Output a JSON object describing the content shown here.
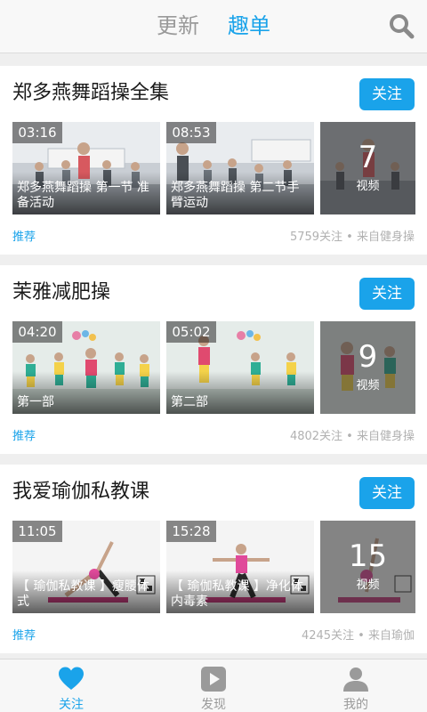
{
  "header": {
    "tabs": [
      {
        "label": "更新"
      },
      {
        "label": "趣单"
      }
    ],
    "search_icon": "search-icon",
    "accent": "#1aa3ea"
  },
  "playlists": [
    {
      "title": "郑多燕舞蹈操全集",
      "follow_label": "关注",
      "tag": "推荐",
      "meta": "5759关注 • 来自健身操",
      "videos": [
        {
          "duration": "03:16",
          "caption": "郑多燕舞蹈操 第一节 准备活动"
        },
        {
          "duration": "08:53",
          "caption": "郑多燕舞蹈操 第二节手臂运动"
        }
      ],
      "more": {
        "count": "7",
        "unit": "视频"
      }
    },
    {
      "title": "茉雅减肥操",
      "follow_label": "关注",
      "tag": "推荐",
      "meta": "4802关注 • 来自健身操",
      "videos": [
        {
          "duration": "04:20",
          "caption": "第一部"
        },
        {
          "duration": "05:02",
          "caption": "第二部"
        }
      ],
      "more": {
        "count": "9",
        "unit": "视频"
      }
    },
    {
      "title": "我爱瑜伽私教课",
      "follow_label": "关注",
      "tag": "推荐",
      "meta": "4245关注 • 来自瑜伽",
      "videos": [
        {
          "duration": "11:05",
          "caption": "【 瑜伽私教课 】瘦腰体式"
        },
        {
          "duration": "15:28",
          "caption": "【 瑜伽私教课 】净化体内毒素"
        }
      ],
      "more": {
        "count": "15",
        "unit": "视频"
      }
    }
  ],
  "bottom_nav": [
    {
      "label": "关注",
      "icon": "heart-icon",
      "active": true
    },
    {
      "label": "发现",
      "icon": "play-icon",
      "active": false
    },
    {
      "label": "我的",
      "icon": "person-icon",
      "active": false
    }
  ]
}
